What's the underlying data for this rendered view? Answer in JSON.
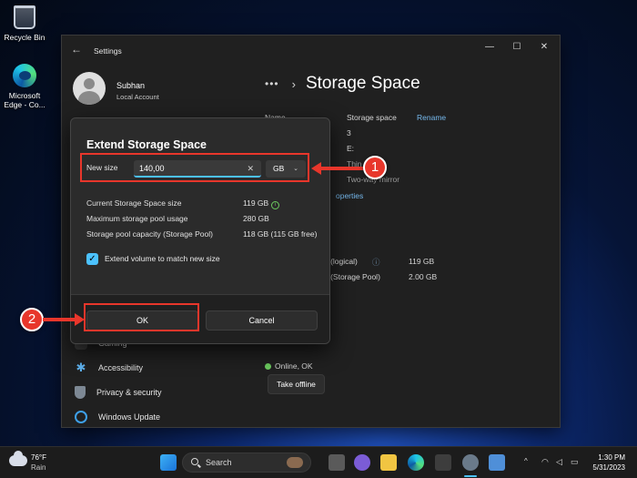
{
  "desktop": {
    "icons": [
      {
        "label": "Recycle Bin",
        "icon": "recycle-bin-icon"
      },
      {
        "label": "Microsoft Edge - Co...",
        "icon": "edge-icon"
      }
    ]
  },
  "window": {
    "title": "Settings",
    "user": {
      "name": "Subhan",
      "account_type": "Local Account"
    },
    "breadcrumb": {
      "dots": "•••",
      "title": "Storage Space"
    },
    "properties": {
      "name_label": "Name",
      "name_value": "Storage space",
      "rename_link": "Rename",
      "value_3": "3",
      "value_e": "E:",
      "value_thin": "Thin",
      "value_mirror": "Two-way mirror",
      "properties_link": "operties",
      "logical_label": "e (logical)",
      "logical_value": "119 GB",
      "pool_label": "d (Storage Pool)",
      "pool_value": "2.00 GB",
      "status": "Online, OK",
      "take_offline": "Take offline"
    },
    "nav": [
      {
        "label": "Gaming",
        "icon": "gaming-icon"
      },
      {
        "label": "Accessibility",
        "icon": "accessibility-icon"
      },
      {
        "label": "Privacy & security",
        "icon": "shield-icon"
      },
      {
        "label": "Windows Update",
        "icon": "windows-update-icon"
      }
    ]
  },
  "dialog": {
    "title": "Extend Storage Space",
    "new_size_label": "New size",
    "new_size_value": "140,00",
    "unit": "GB",
    "info": [
      {
        "label": "Current Storage Space size",
        "value": "119 GB"
      },
      {
        "label": "Maximum storage pool usage",
        "value": "280 GB"
      },
      {
        "label": "Storage pool capacity (Storage Pool)",
        "value": "118 GB (115 GB free)"
      }
    ],
    "checkbox_label": "Extend volume to match new size",
    "checkbox_checked": true,
    "ok": "OK",
    "cancel": "Cancel"
  },
  "annotations": {
    "step1": "1",
    "step2": "2",
    "color": "#e8362b"
  },
  "taskbar": {
    "weather_temp": "76°F",
    "weather_desc": "Rain",
    "search_placeholder": "Search",
    "time": "1:30 PM",
    "date": "5/31/2023"
  }
}
